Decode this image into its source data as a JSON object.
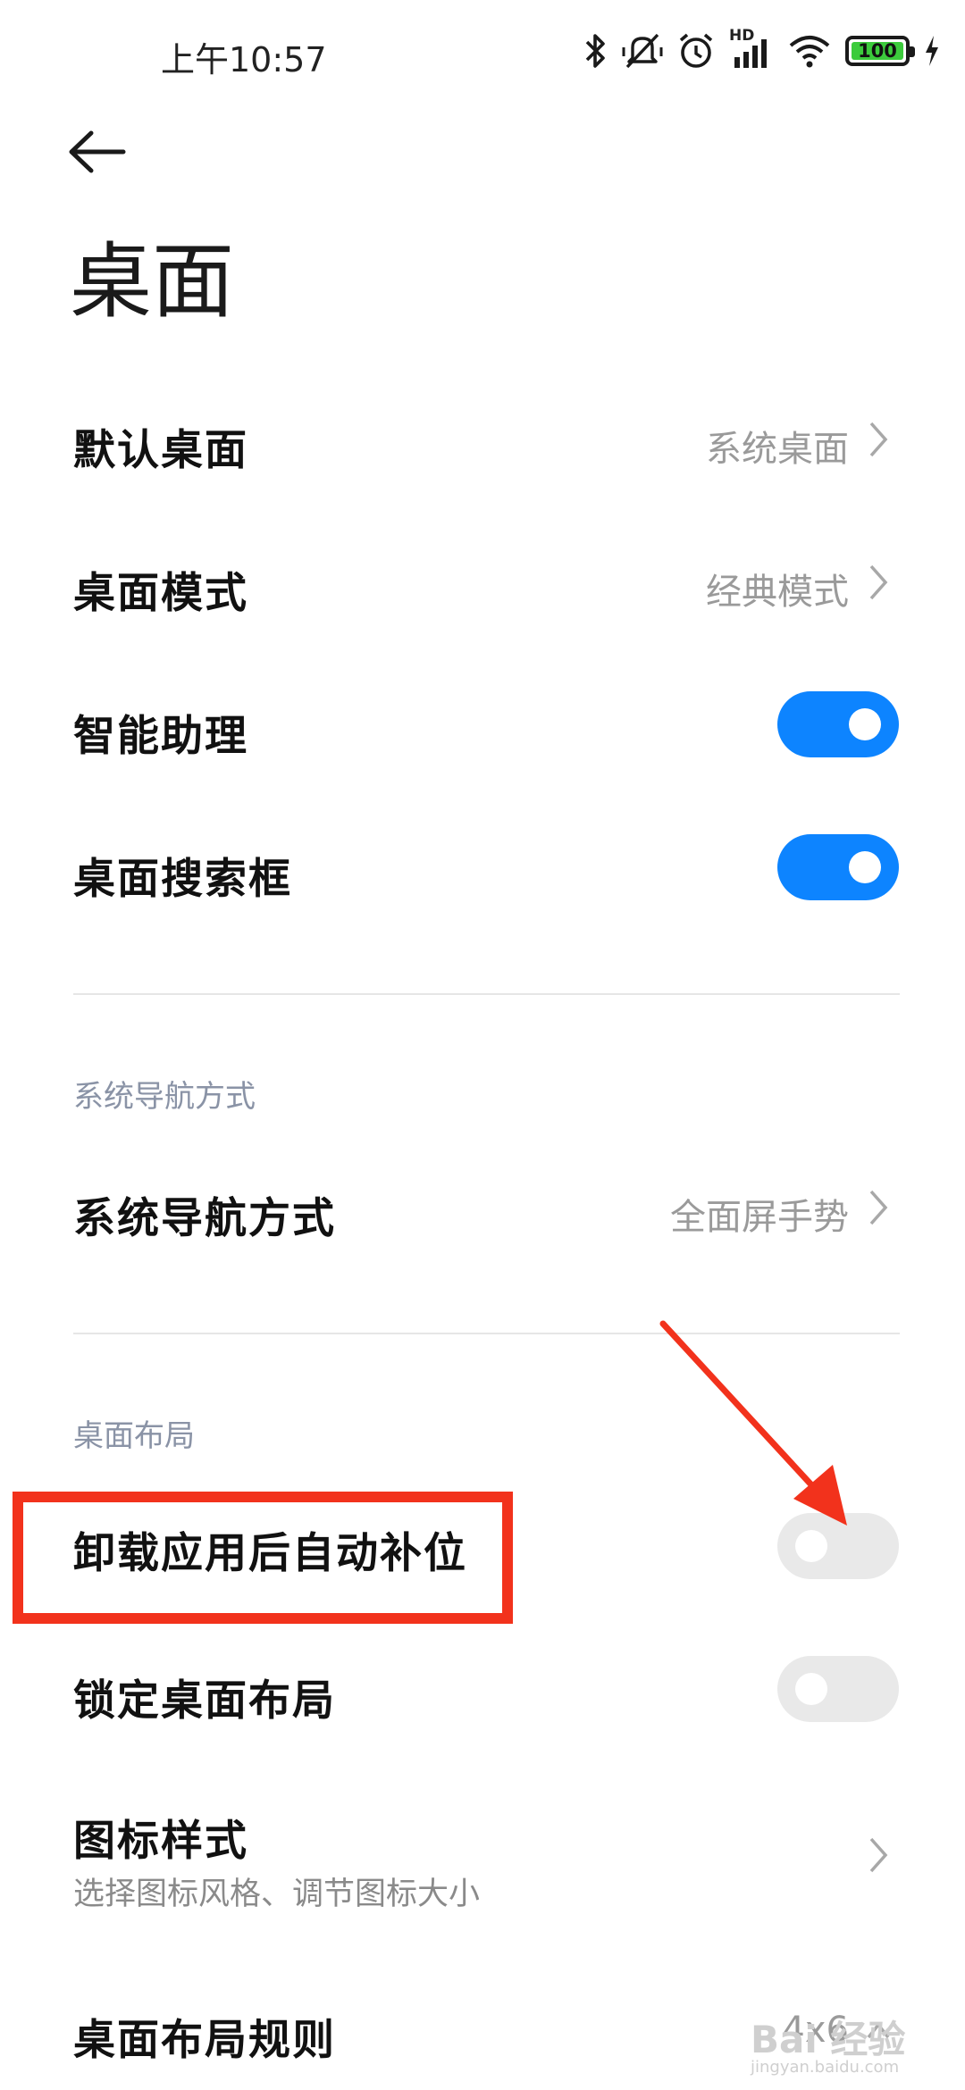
{
  "status_bar": {
    "time": "上午10:57",
    "hd_label": "HD",
    "battery": "100",
    "icons": [
      "bluetooth-icon",
      "mute-vibrate-icon",
      "alarm-icon",
      "signal-icon",
      "wifi-icon",
      "battery-icon",
      "charging-icon"
    ]
  },
  "header": {
    "title": "桌面",
    "back_icon": "arrow-left-icon"
  },
  "settings": {
    "default_launcher": {
      "label": "默认桌面",
      "value": "系统桌面"
    },
    "launcher_mode": {
      "label": "桌面模式",
      "value": "经典模式"
    },
    "smart_assistant": {
      "label": "智能助理",
      "enabled": true
    },
    "search_bar": {
      "label": "桌面搜索框",
      "enabled": true
    }
  },
  "nav_section": {
    "header": "系统导航方式",
    "nav_mode": {
      "label": "系统导航方式",
      "value": "全面屏手势"
    }
  },
  "layout_section": {
    "header": "桌面布局",
    "auto_fill": {
      "label": "卸载应用后自动补位",
      "enabled": false
    },
    "lock_layout": {
      "label": "锁定桌面布局",
      "enabled": false
    },
    "icon_style": {
      "label": "图标样式",
      "subtitle": "选择图标风格、调节图标大小"
    },
    "layout_rule": {
      "label": "桌面布局规则",
      "value": "4x6"
    }
  },
  "colors": {
    "toggle_on": "#0d84ff",
    "toggle_off": "#e9e9e9",
    "annotation": "#f2321c"
  },
  "watermark": {
    "text": "Bai 经验",
    "sub": "jingyan.baidu.com"
  }
}
